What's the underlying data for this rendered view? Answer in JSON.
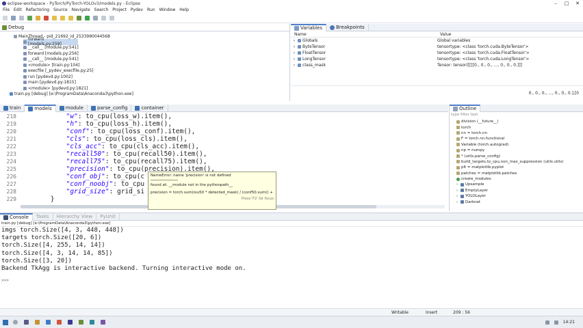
{
  "window": {
    "title": "eclipse-workspace - PyTorch/PyTorch-YOLOv3/models.py - Eclipse",
    "menu": [
      "File",
      "Edit",
      "Refactoring",
      "Source",
      "Navigate",
      "Search",
      "Project",
      "Pydev",
      "Run",
      "Window",
      "Help"
    ]
  },
  "debug": {
    "title": "Debug",
    "thread": "MainThread - pid_21692_id_2533990044568",
    "frames": [
      "forward [models.py:259]",
      "__call__ [module.py:541]",
      "forward [models.py:256]",
      "__call__ [module.py:541]",
      "<module> [train.py:104]",
      "execfile [_pydev_execfile.py:25]",
      "run [pydevd.py:1002]",
      "main [pydevd.py:1815]",
      "<module> [pydevd.py:1821]"
    ],
    "process": "train.py [debug] [e:\\ProgramData\\Anaconda3\\python.exe]"
  },
  "variables": {
    "tabs": [
      "Variables",
      "Breakpoints"
    ],
    "col_name": "Name",
    "col_value": "Value",
    "rows": [
      {
        "name": "Globals",
        "value": "Global variables"
      },
      {
        "name": "ByteTensor",
        "value": "tensortype: <class 'torch.cuda.ByteTensor'>"
      },
      {
        "name": "FloatTensor",
        "value": "tensortype: <class 'torch.cuda.FloatTensor'>"
      },
      {
        "name": "LongTensor",
        "value": "tensortype: <class 'torch.cuda.LongTensor'>"
      },
      {
        "name": "class_mask",
        "value": "Tensor: tensor([[[[0., 0., 0., ..., 0., 0., 0.]]]"
      }
    ],
    "status_right": "0., 0., 0., ..., 0., 0., 0.],[0"
  },
  "editor": {
    "tabs": [
      "train",
      "models",
      "module",
      "parse_config",
      "container"
    ],
    "active_tab": "models",
    "lines": [
      {
        "num": "218",
        "code": "            \"w\": to_cpu(loss_w).item(),"
      },
      {
        "num": "219",
        "code": "            \"h\": to_cpu(loss_h).item(),"
      },
      {
        "num": "220",
        "code": "            \"conf\": to_cpu(loss_conf).item(),"
      },
      {
        "num": "221",
        "code": "            \"cls\": to_cpu(loss_cls).item(),"
      },
      {
        "num": "222",
        "code": "            \"cls_acc\": to_cpu(cls_acc).item(),"
      },
      {
        "num": "223",
        "code": "            \"recall50\": to_cpu(recall50).item(),"
      },
      {
        "num": "224",
        "code": "            \"recall75\": to_cpu(recall75).item(),"
      },
      {
        "num": "225",
        "code": "            \"precision\": to_cpu(precision).item(),"
      },
      {
        "num": "226",
        "code": "            \"conf_obj\": to_cpu(c"
      },
      {
        "num": "227",
        "code": "            \"conf_noobj\": to_cpu"
      },
      {
        "num": "228",
        "code": "            \"grid_size\": grid_si"
      },
      {
        "num": "229",
        "code": "        }"
      }
    ],
    "tooltip": {
      "line1": "NameError: name 'precision' is not defined",
      "line2": "found at: __module not in the pythonpath__",
      "line3": "precision = torch.sum(iou50 * detected_mask) / (conf50.sum() + 1e-16)",
      "footer": "Press 'F2' for focus"
    }
  },
  "outline": {
    "title": "Outline",
    "filter": "type filter text",
    "items": [
      "division (__future__)",
      "torch",
      "nn = torch.nn",
      "F = torch.nn.functional",
      "Variable (torch.autograd)",
      "np = numpy",
      "* (utils.parse_config)",
      "build_targets,to_cpu,non_max_suppression (utils.utils)",
      "plt = matplotlib.pyplot",
      "patches = matplotlib.patches",
      "create_modules",
      "Upsample",
      "EmptyLayer",
      "YOLOLayer",
      "Darknet"
    ]
  },
  "console": {
    "tabs": [
      "Console",
      "Tasks",
      "Hierarchy View",
      "PyUnit"
    ],
    "process": "train.py [debug] [e:\\ProgramData\\Anaconda3\\python.exe]",
    "lines": [
      "imgs torch.Size([4, 3, 448, 448])",
      "targets torch.Size([20, 6])",
      "torch.Size([4, 255, 14, 14])",
      "torch.Size([4, 3, 14, 14, 85])",
      "torch.Size([3, 20])",
      "Backend TkAgg is interactive backend. Turning interactive mode on."
    ],
    "prompt": ">>>"
  },
  "statusbar": {
    "mode": "Writable",
    "insert": "Insert",
    "position": "209 : 56"
  },
  "taskbar": {
    "time": "14:21"
  },
  "colors": {
    "keyword_string": "#2a00ff",
    "tab_accent": "#4f7ec7",
    "frame_highlight": "#c6d9f1"
  }
}
